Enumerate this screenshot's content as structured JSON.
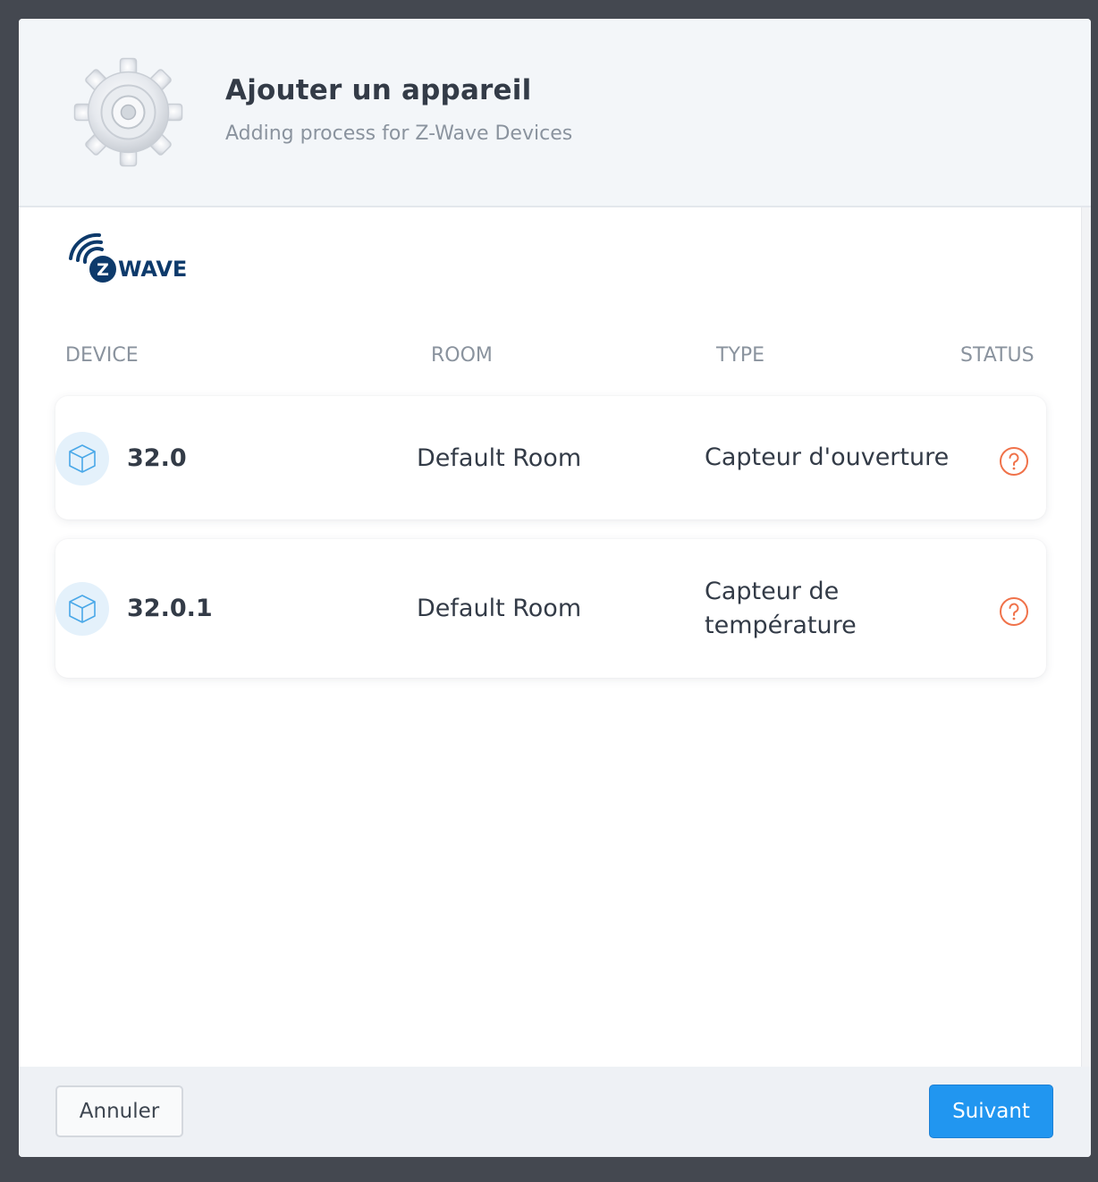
{
  "header": {
    "title": "Ajouter un appareil",
    "subtitle": "Adding process for Z-Wave Devices",
    "icon": "gear-icon"
  },
  "brand": {
    "logo": "zwave-logo",
    "logo_text": "WAVE",
    "logo_letter": "Z",
    "color": "#0d3a6b"
  },
  "table": {
    "columns": [
      "DEVICE",
      "ROOM",
      "TYPE",
      "STATUS"
    ],
    "rows": [
      {
        "device": "32.0",
        "room": "Default Room",
        "type": "Capteur d'ouverture",
        "status_icon": "question-circle-icon"
      },
      {
        "device": "32.0.1",
        "room": "Default Room",
        "type": "Capteur de température",
        "status_icon": "question-circle-icon"
      }
    ]
  },
  "footer": {
    "cancel_label": "Annuler",
    "next_label": "Suivant"
  },
  "colors": {
    "accent": "#2196f0",
    "status_unknown": "#f0724a",
    "device_icon": "#4aa8e8"
  }
}
